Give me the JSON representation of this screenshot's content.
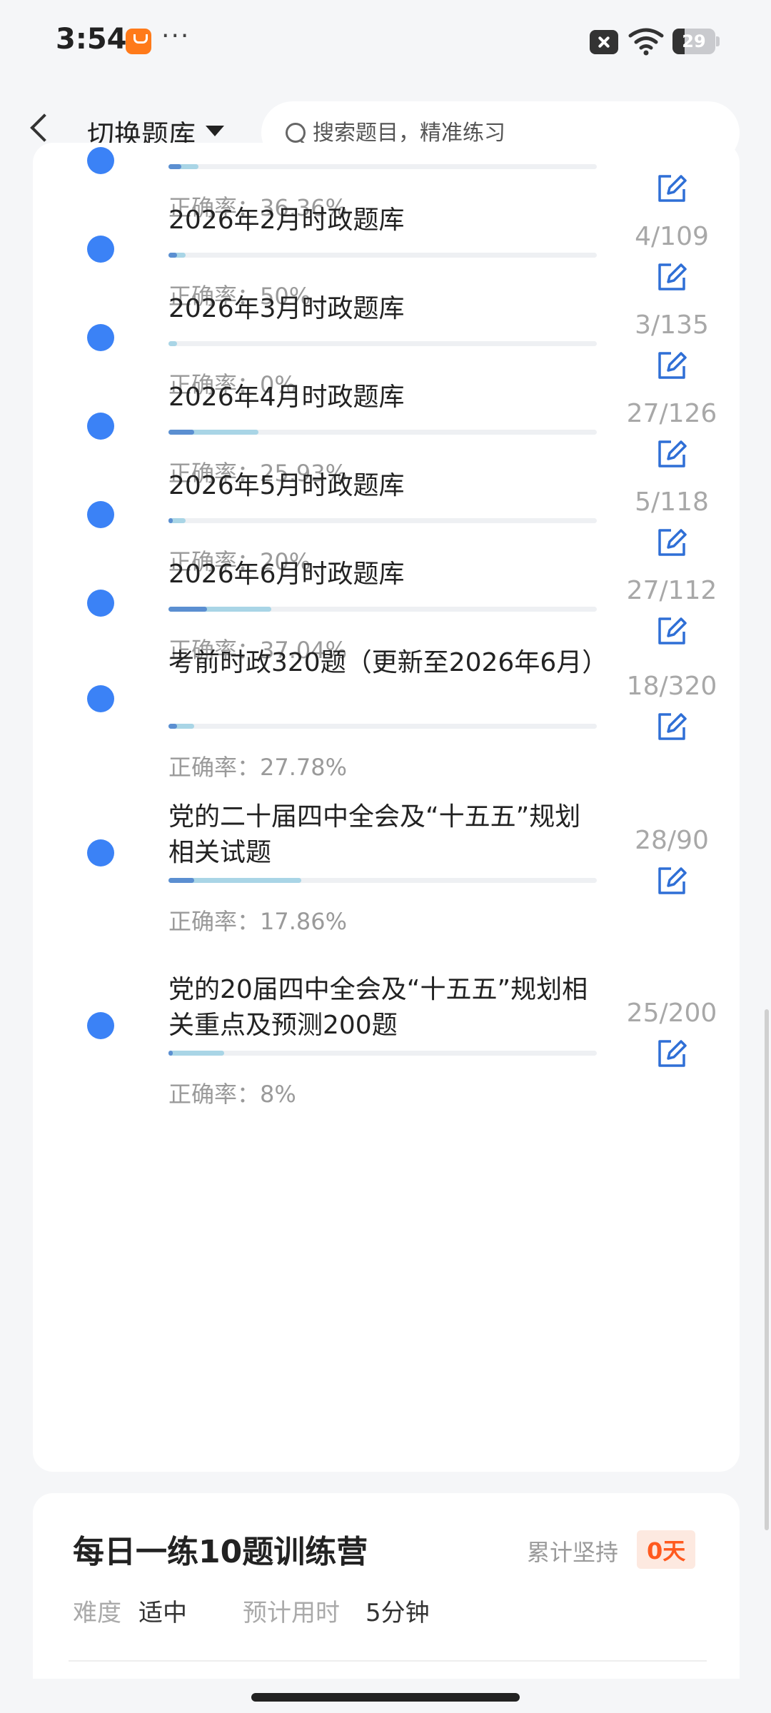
{
  "status_bar": {
    "time": "3:54",
    "dots": "···",
    "battery": "29"
  },
  "header": {
    "switch_label": "切换题库",
    "search_placeholder": "搜索题目，精准练习"
  },
  "items": [
    {
      "title": "",
      "accuracy": "正确率：36.36%",
      "count": "",
      "progress_done": 0.03,
      "progress_total": 0.07
    },
    {
      "title": "2026年2月时政题库",
      "accuracy": "正确率：50%",
      "count": "4/109",
      "progress_done": 0.02,
      "progress_total": 0.04
    },
    {
      "title": "2026年3月时政题库",
      "accuracy": "正确率：0%",
      "count": "3/135",
      "progress_done": 0.0,
      "progress_total": 0.02
    },
    {
      "title": "2026年4月时政题库",
      "accuracy": "正确率：25.93%",
      "count": "27/126",
      "progress_done": 0.06,
      "progress_total": 0.21
    },
    {
      "title": "2026年5月时政题库",
      "accuracy": "正确率：20%",
      "count": "5/118",
      "progress_done": 0.01,
      "progress_total": 0.04
    },
    {
      "title": "2026年6月时政题库",
      "accuracy": "正确率：37.04%",
      "count": "27/112",
      "progress_done": 0.09,
      "progress_total": 0.24
    },
    {
      "title": "考前时政320题（更新至2026年6月）",
      "accuracy": "正确率：27.78%",
      "count": "18/320",
      "progress_done": 0.02,
      "progress_total": 0.06
    },
    {
      "title": "党的二十届四中全会及“十五五”规划相关试题",
      "accuracy": "正确率：17.86%",
      "count": "28/90",
      "progress_done": 0.06,
      "progress_total": 0.31
    },
    {
      "title": "党的20届四中全会及“十五五”规划相关重点及预测200题",
      "accuracy": "正确率：8%",
      "count": "25/200",
      "progress_done": 0.01,
      "progress_total": 0.13
    }
  ],
  "training": {
    "title": "每日一练10题训练营",
    "persist_label": "累计坚持",
    "persist_days": "0天",
    "difficulty_label": "难度",
    "difficulty_value": "适中",
    "time_label": "预计用时",
    "time_value": "5分钟"
  },
  "colors": {
    "bullet": "#3b82f6",
    "accent": "#ff5a1f",
    "bar_light": "#a9d5e6",
    "bar_dark": "#5b8fd1",
    "edit_icon": "#2f6fd6"
  }
}
